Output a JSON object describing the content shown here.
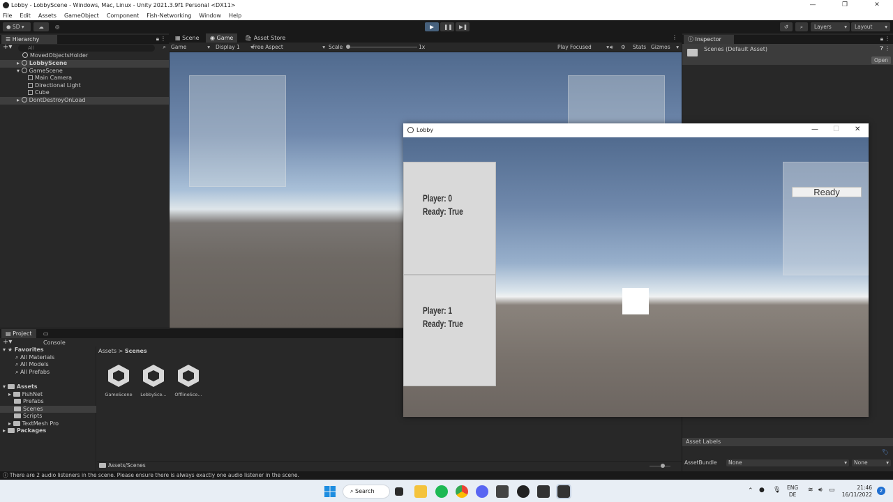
{
  "window": {
    "title": "Lobby - LobbyScene - Windows, Mac, Linux - Unity 2021.3.9f1 Personal <DX11>",
    "minimize": "—",
    "maximize": "❐",
    "close": "✕"
  },
  "menu": [
    "File",
    "Edit",
    "Assets",
    "GameObject",
    "Component",
    "Fish-Networking",
    "Window",
    "Help"
  ],
  "toolbar": {
    "account": "SD",
    "layers": "Layers",
    "layout": "Layout"
  },
  "hierarchy": {
    "tab": "Hierarchy",
    "search_placeholder": "All",
    "items": [
      {
        "label": "MovedObjectsHolder"
      },
      {
        "label": "LobbyScene"
      },
      {
        "label": "GameScene"
      },
      {
        "label": "Main Camera"
      },
      {
        "label": "Directional Light"
      },
      {
        "label": "Cube"
      },
      {
        "label": "DontDestroyOnLoad"
      }
    ]
  },
  "center_tabs": [
    "Scene",
    "Game",
    "Asset Store"
  ],
  "game_bar": {
    "mode": "Game",
    "display": "Display 1",
    "aspect": "Free Aspect",
    "scale_label": "Scale",
    "scale_value": "1x",
    "play_focused": "Play Focused",
    "stats": "Stats",
    "gizmos": "Gizmos"
  },
  "inspector": {
    "tab": "Inspector",
    "asset": "Scenes (Default Asset)",
    "open": "Open",
    "asset_labels": "Asset Labels",
    "asset_bundle": "AssetBundle",
    "bundle_value": "None",
    "variant_value": "None"
  },
  "project": {
    "tabs": [
      "Project",
      "Console"
    ],
    "favorites_label": "Favorites",
    "favorites": [
      "All Materials",
      "All Models",
      "All Prefabs"
    ],
    "assets_label": "Assets",
    "folders": [
      "FishNet",
      "Prefabs",
      "Scenes",
      "Scripts",
      "TextMesh Pro"
    ],
    "packages_label": "Packages",
    "breadcrumb_root": "Assets",
    "breadcrumb_current": "Scenes",
    "files": [
      "GameScene",
      "LobbySce...",
      "OfflineSce..."
    ],
    "footer_path": "Assets/Scenes"
  },
  "lobby_window": {
    "title": "Lobby",
    "players": [
      {
        "line1": "Player: 0",
        "line2": "Ready: True"
      },
      {
        "line1": "Player: 1",
        "line2": "Ready: True"
      }
    ],
    "ready_button": "Ready"
  },
  "status_message": "There are 2 audio listeners in the scene. Please ensure there is always exactly one audio listener in the scene.",
  "taskbar": {
    "search": "Search",
    "lang_top": "ENG",
    "lang_bottom": "DE",
    "time": "21:46",
    "date": "16/11/2022",
    "notification_count": "2"
  },
  "colors": {
    "play_active": "#46607c",
    "panel": "#282828",
    "card": "#d9d9d9"
  }
}
